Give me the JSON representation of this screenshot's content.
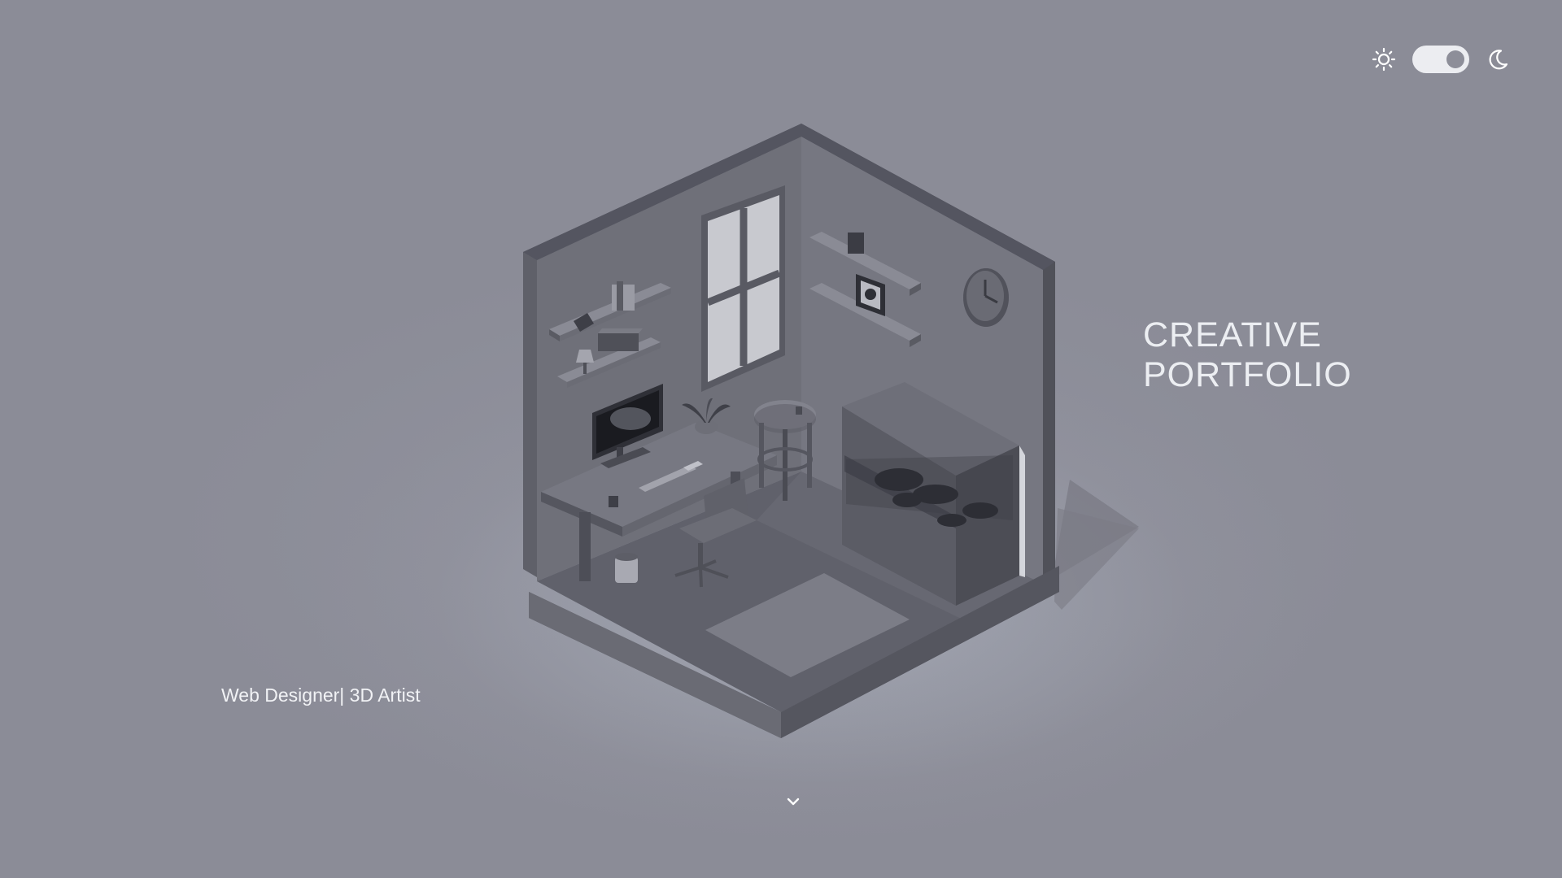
{
  "header": {
    "theme_toggle": {
      "light_icon": "sun-icon",
      "dark_icon": "moon-icon",
      "state": "dark"
    }
  },
  "hero": {
    "title_line1": "CREATIVE",
    "title_line2": "PORTFOLIO",
    "subtitle": "Web Designer| 3D Artist"
  },
  "scroll": {
    "icon": "chevron-down-icon"
  },
  "illustration": {
    "name": "isometric-room",
    "icons": [
      "wall-clock-icon",
      "monitor-icon",
      "desk-chair-icon",
      "plant-icon",
      "picture-frame-icon"
    ]
  },
  "colors": {
    "background": "#8d8e99",
    "text": "#eceef2",
    "toggle_track": "#ecedf1",
    "toggle_knob": "#8d8e99"
  }
}
